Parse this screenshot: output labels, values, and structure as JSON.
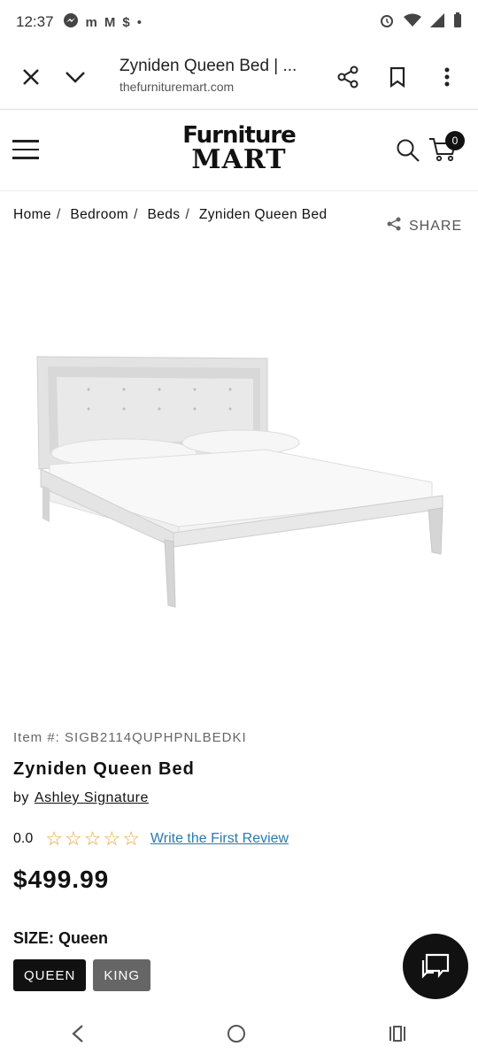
{
  "status_bar": {
    "time": "12:37",
    "icons": [
      "messenger-icon",
      "m-icon",
      "gmail-icon",
      "dollar-icon",
      "dot-icon"
    ],
    "right_icons": [
      "alarm-icon",
      "wifi-icon",
      "signal-icon",
      "battery-icon"
    ]
  },
  "browser": {
    "page_title": "Zyniden Queen Bed | ...",
    "domain": "thefurnituremart.com"
  },
  "site": {
    "logo_line1": "Furniture",
    "logo_line2": "MART",
    "cart_count": "0"
  },
  "breadcrumb": [
    "Home",
    "Bedroom",
    "Beds",
    "Zyniden Queen Bed"
  ],
  "share_label": "SHARE",
  "product": {
    "item_number": "Item #: SIGB2114QUPHPNLBEDKI",
    "name": "Zyniden Queen Bed",
    "by_prefix": "by",
    "brand": "Ashley Signature",
    "rating": "0.0",
    "review_link": "Write the First Review",
    "price": "$499.99",
    "size_label": "SIZE: Queen",
    "sizes": [
      "QUEEN",
      "KING"
    ]
  },
  "colors": {
    "star": "#e8a33a",
    "link": "#2a7ab0",
    "active_size": "#111111",
    "inactive_size": "#666666"
  }
}
